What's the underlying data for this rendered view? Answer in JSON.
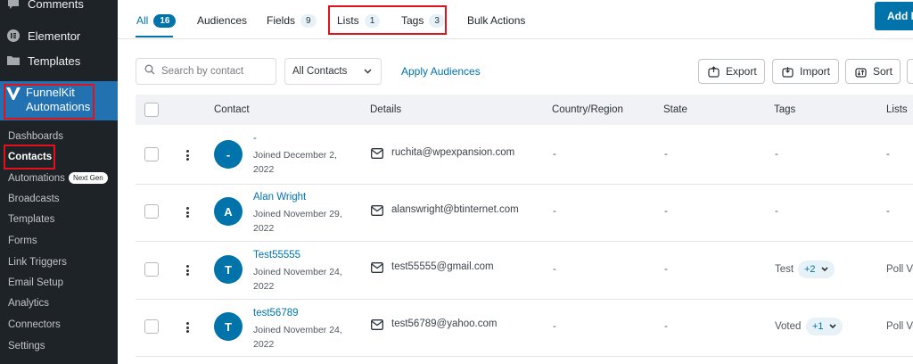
{
  "sidebar": {
    "top_items": [
      {
        "label": "Comments",
        "icon": "comment-icon"
      },
      {
        "label": "Elementor",
        "icon": "elementor-icon"
      },
      {
        "label": "Templates",
        "icon": "folder-icon"
      }
    ],
    "plugin": {
      "title_line1": "FunnelKit",
      "title_line2": "Automations"
    },
    "submenu": {
      "dashboards": "Dashboards",
      "contacts": "Contacts",
      "automations": "Automations",
      "automations_badge": "Next Gen",
      "broadcasts": "Broadcasts",
      "templates": "Templates",
      "forms": "Forms",
      "link_triggers": "Link Triggers",
      "email_setup": "Email Setup",
      "analytics": "Analytics",
      "connectors": "Connectors",
      "settings": "Settings"
    }
  },
  "tabs": {
    "all": {
      "label": "All",
      "count": "16"
    },
    "audiences": {
      "label": "Audiences"
    },
    "fields": {
      "label": "Fields",
      "count": "9"
    },
    "lists": {
      "label": "Lists",
      "count": "1"
    },
    "tags": {
      "label": "Tags",
      "count": "3"
    },
    "bulk": {
      "label": "Bulk Actions"
    },
    "add_button": "Add N"
  },
  "toolbar": {
    "search_placeholder": "Search by contact",
    "filter_value": "All Contacts",
    "apply_label": "Apply Audiences",
    "export_label": "Export",
    "import_label": "Import",
    "sort_label": "Sort"
  },
  "table": {
    "headers": {
      "contact": "Contact",
      "details": "Details",
      "country": "Country/Region",
      "state": "State",
      "tags": "Tags",
      "lists": "Lists"
    },
    "rows": [
      {
        "initial": "-",
        "name": "-",
        "joined": "Joined December 2, 2022",
        "email": "ruchita@wpexpansion.com",
        "country": "-",
        "state": "-",
        "tags": "-",
        "tag_more": "",
        "lists": "-"
      },
      {
        "initial": "A",
        "name": "Alan Wright",
        "joined": "Joined November 29, 2022",
        "email": "alanswright@btinternet.com",
        "country": "-",
        "state": "-",
        "tags": "-",
        "tag_more": "",
        "lists": "-"
      },
      {
        "initial": "T",
        "name": "Test55555",
        "joined": "Joined November 24, 2022",
        "email": "test55555@gmail.com",
        "country": "-",
        "state": "-",
        "tags": "Test",
        "tag_more": "+2",
        "lists": "Poll Vo"
      },
      {
        "initial": "T",
        "name": "test56789",
        "joined": "Joined November 24, 2022",
        "email": "test56789@yahoo.com",
        "country": "-",
        "state": "-",
        "tags": "Voted",
        "tag_more": "+1",
        "lists": "Poll Vo"
      }
    ]
  },
  "colors": {
    "accent": "#0073aa",
    "sidebar_bg": "#1d2327",
    "sidebar_active": "#2271b1",
    "highlight_red": "#e0131d"
  }
}
